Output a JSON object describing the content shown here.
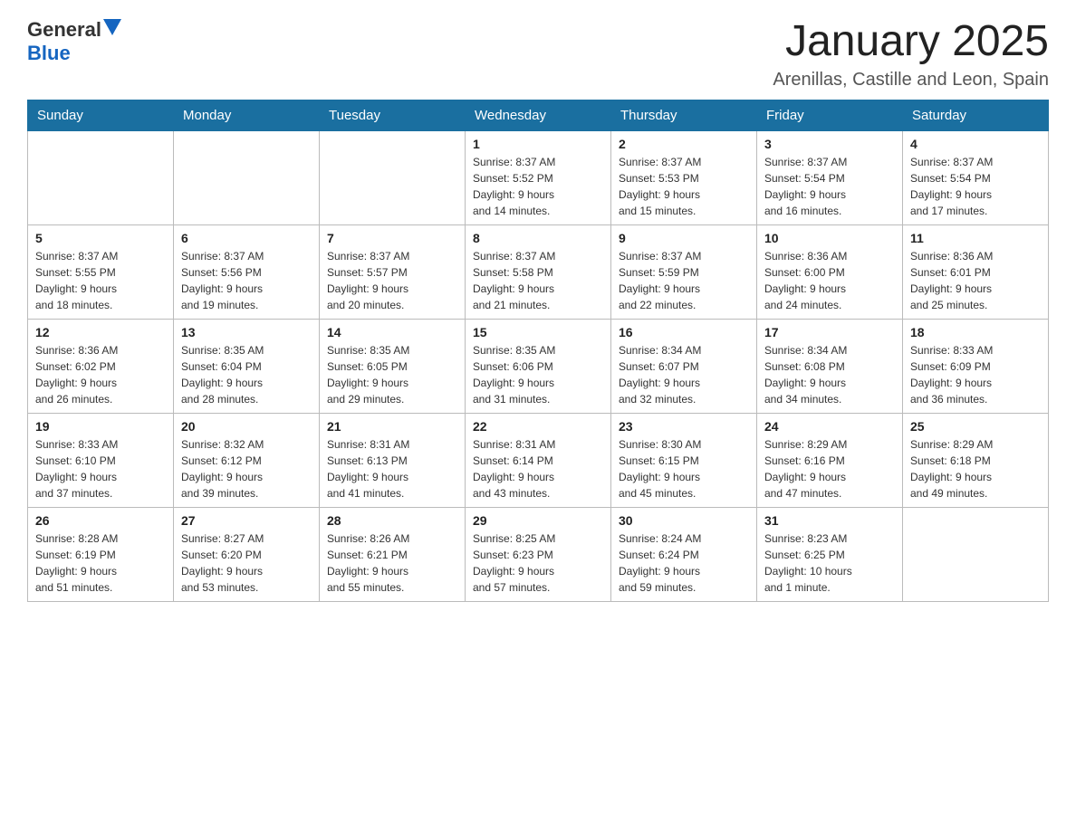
{
  "header": {
    "logo_general": "General",
    "logo_blue": "Blue",
    "month_title": "January 2025",
    "location": "Arenillas, Castille and Leon, Spain"
  },
  "days_of_week": [
    "Sunday",
    "Monday",
    "Tuesday",
    "Wednesday",
    "Thursday",
    "Friday",
    "Saturday"
  ],
  "weeks": [
    [
      {
        "day": "",
        "info": ""
      },
      {
        "day": "",
        "info": ""
      },
      {
        "day": "",
        "info": ""
      },
      {
        "day": "1",
        "info": "Sunrise: 8:37 AM\nSunset: 5:52 PM\nDaylight: 9 hours\nand 14 minutes."
      },
      {
        "day": "2",
        "info": "Sunrise: 8:37 AM\nSunset: 5:53 PM\nDaylight: 9 hours\nand 15 minutes."
      },
      {
        "day": "3",
        "info": "Sunrise: 8:37 AM\nSunset: 5:54 PM\nDaylight: 9 hours\nand 16 minutes."
      },
      {
        "day": "4",
        "info": "Sunrise: 8:37 AM\nSunset: 5:54 PM\nDaylight: 9 hours\nand 17 minutes."
      }
    ],
    [
      {
        "day": "5",
        "info": "Sunrise: 8:37 AM\nSunset: 5:55 PM\nDaylight: 9 hours\nand 18 minutes."
      },
      {
        "day": "6",
        "info": "Sunrise: 8:37 AM\nSunset: 5:56 PM\nDaylight: 9 hours\nand 19 minutes."
      },
      {
        "day": "7",
        "info": "Sunrise: 8:37 AM\nSunset: 5:57 PM\nDaylight: 9 hours\nand 20 minutes."
      },
      {
        "day": "8",
        "info": "Sunrise: 8:37 AM\nSunset: 5:58 PM\nDaylight: 9 hours\nand 21 minutes."
      },
      {
        "day": "9",
        "info": "Sunrise: 8:37 AM\nSunset: 5:59 PM\nDaylight: 9 hours\nand 22 minutes."
      },
      {
        "day": "10",
        "info": "Sunrise: 8:36 AM\nSunset: 6:00 PM\nDaylight: 9 hours\nand 24 minutes."
      },
      {
        "day": "11",
        "info": "Sunrise: 8:36 AM\nSunset: 6:01 PM\nDaylight: 9 hours\nand 25 minutes."
      }
    ],
    [
      {
        "day": "12",
        "info": "Sunrise: 8:36 AM\nSunset: 6:02 PM\nDaylight: 9 hours\nand 26 minutes."
      },
      {
        "day": "13",
        "info": "Sunrise: 8:35 AM\nSunset: 6:04 PM\nDaylight: 9 hours\nand 28 minutes."
      },
      {
        "day": "14",
        "info": "Sunrise: 8:35 AM\nSunset: 6:05 PM\nDaylight: 9 hours\nand 29 minutes."
      },
      {
        "day": "15",
        "info": "Sunrise: 8:35 AM\nSunset: 6:06 PM\nDaylight: 9 hours\nand 31 minutes."
      },
      {
        "day": "16",
        "info": "Sunrise: 8:34 AM\nSunset: 6:07 PM\nDaylight: 9 hours\nand 32 minutes."
      },
      {
        "day": "17",
        "info": "Sunrise: 8:34 AM\nSunset: 6:08 PM\nDaylight: 9 hours\nand 34 minutes."
      },
      {
        "day": "18",
        "info": "Sunrise: 8:33 AM\nSunset: 6:09 PM\nDaylight: 9 hours\nand 36 minutes."
      }
    ],
    [
      {
        "day": "19",
        "info": "Sunrise: 8:33 AM\nSunset: 6:10 PM\nDaylight: 9 hours\nand 37 minutes."
      },
      {
        "day": "20",
        "info": "Sunrise: 8:32 AM\nSunset: 6:12 PM\nDaylight: 9 hours\nand 39 minutes."
      },
      {
        "day": "21",
        "info": "Sunrise: 8:31 AM\nSunset: 6:13 PM\nDaylight: 9 hours\nand 41 minutes."
      },
      {
        "day": "22",
        "info": "Sunrise: 8:31 AM\nSunset: 6:14 PM\nDaylight: 9 hours\nand 43 minutes."
      },
      {
        "day": "23",
        "info": "Sunrise: 8:30 AM\nSunset: 6:15 PM\nDaylight: 9 hours\nand 45 minutes."
      },
      {
        "day": "24",
        "info": "Sunrise: 8:29 AM\nSunset: 6:16 PM\nDaylight: 9 hours\nand 47 minutes."
      },
      {
        "day": "25",
        "info": "Sunrise: 8:29 AM\nSunset: 6:18 PM\nDaylight: 9 hours\nand 49 minutes."
      }
    ],
    [
      {
        "day": "26",
        "info": "Sunrise: 8:28 AM\nSunset: 6:19 PM\nDaylight: 9 hours\nand 51 minutes."
      },
      {
        "day": "27",
        "info": "Sunrise: 8:27 AM\nSunset: 6:20 PM\nDaylight: 9 hours\nand 53 minutes."
      },
      {
        "day": "28",
        "info": "Sunrise: 8:26 AM\nSunset: 6:21 PM\nDaylight: 9 hours\nand 55 minutes."
      },
      {
        "day": "29",
        "info": "Sunrise: 8:25 AM\nSunset: 6:23 PM\nDaylight: 9 hours\nand 57 minutes."
      },
      {
        "day": "30",
        "info": "Sunrise: 8:24 AM\nSunset: 6:24 PM\nDaylight: 9 hours\nand 59 minutes."
      },
      {
        "day": "31",
        "info": "Sunrise: 8:23 AM\nSunset: 6:25 PM\nDaylight: 10 hours\nand 1 minute."
      },
      {
        "day": "",
        "info": ""
      }
    ]
  ]
}
